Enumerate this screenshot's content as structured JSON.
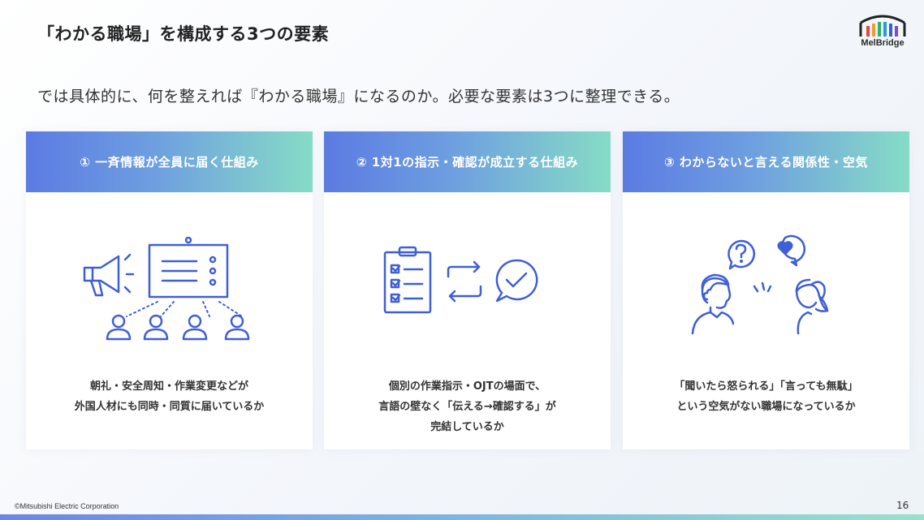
{
  "slide": {
    "title": "「わかる職場」を構成する3つの要素",
    "subtitle": "では具体的に、何を整えれば『わかる職場』になるのか。必要な要素は3つに整理できる。",
    "logo": {
      "text": "MelBridge",
      "icon": "melbridge-logo-icon"
    },
    "footer": {
      "copyright": "©Mitsubishi Electric Corporation",
      "page_number": "16"
    },
    "colors": {
      "header_gradient_start": "#5b7be2",
      "header_gradient_end": "#86dcc6",
      "icon_blue": "#3f5fd6"
    }
  },
  "cards": [
    {
      "heading": "① 一斉情報が全員に届く仕組み",
      "icon": "broadcast-to-team-icon",
      "lines": [
        "朝礼・安全周知・作業変更などが",
        "外国人材にも同時・同質に届いているか"
      ]
    },
    {
      "heading": "②  1対1の指示・確認が成立する仕組み",
      "icon": "checklist-exchange-icon",
      "lines": [
        "個別の作業指示・OJTの場面で、",
        "言語の壁なく「伝える→確認する」が",
        "完結しているか"
      ]
    },
    {
      "heading": "③ わからないと言える関係性・空気",
      "icon": "question-and-heart-conversation-icon",
      "lines": [
        "「聞いたら怒られる」「言っても無駄」",
        "という空気がない職場になっているか"
      ]
    }
  ]
}
